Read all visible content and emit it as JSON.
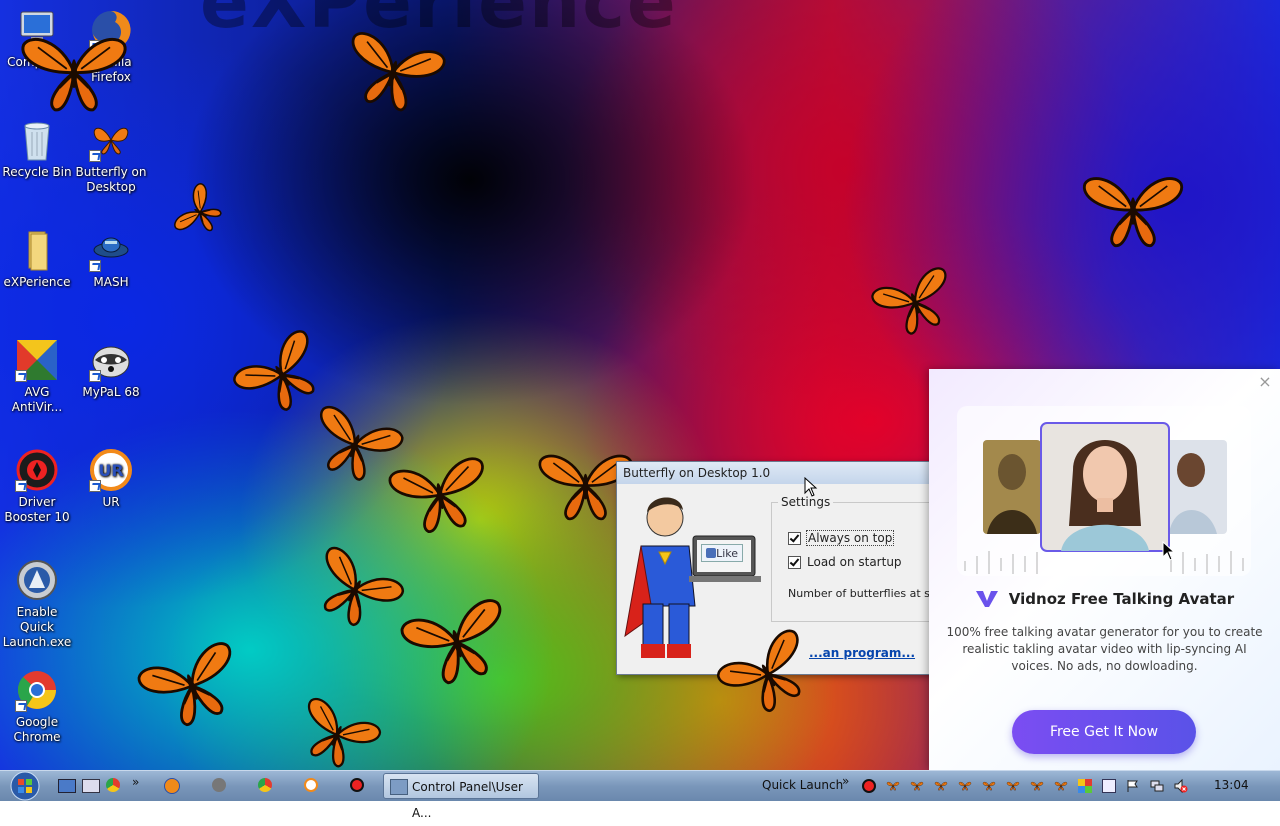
{
  "wallpaper": {
    "text": "eXPerience"
  },
  "desktop_icons": [
    {
      "label": "Computer",
      "icon": "computer-icon"
    },
    {
      "label": "Mozilla Firefox",
      "icon": "firefox-icon"
    },
    {
      "label": "Recycle Bin",
      "icon": "recycle-bin-icon"
    },
    {
      "label": "Butterfly on Desktop",
      "icon": "butterfly-icon"
    },
    {
      "label": "eXPerience",
      "icon": "folder-icon"
    },
    {
      "label": "MASH",
      "icon": "mash-icon"
    },
    {
      "label": "AVG AntiVir...",
      "icon": "avg-icon"
    },
    {
      "label": "MyPaL 68",
      "icon": "mypal-icon"
    },
    {
      "label": "Driver Booster 10",
      "icon": "driver-booster-icon"
    },
    {
      "label": "UR",
      "icon": "ur-browser-icon"
    },
    {
      "label": "Enable Quick Launch.exe",
      "icon": "quick-launch-icon"
    },
    {
      "label": "Google Chrome",
      "icon": "chrome-icon"
    }
  ],
  "butterfly_dialog": {
    "title": "Butterfly on Desktop 1.0",
    "settings_legend": "Settings",
    "always_on_top": "Always on top",
    "load_on_startup": "Load on startup",
    "number_label": "Number of butterflies at start",
    "link_text": "...an program...",
    "like_label": "Like"
  },
  "vidnoz_popup": {
    "title": "Vidnoz Free Talking Avatar",
    "description": "100% free talking avatar generator for you to create realistic takling avatar video with lip-syncing AI voices. No ads, no dowloading.",
    "cta": "Free Get It Now",
    "close": "×"
  },
  "taskbar": {
    "active_window": "Control Panel\\User A...",
    "quick_launch_label": "Quick Launch",
    "chevron": "»",
    "clock": "13:04"
  },
  "colors": {
    "butterfly_orange": "#f07a12",
    "cta_purple": "#6a4ff0",
    "taskbar_blue": "#7a97ba"
  }
}
